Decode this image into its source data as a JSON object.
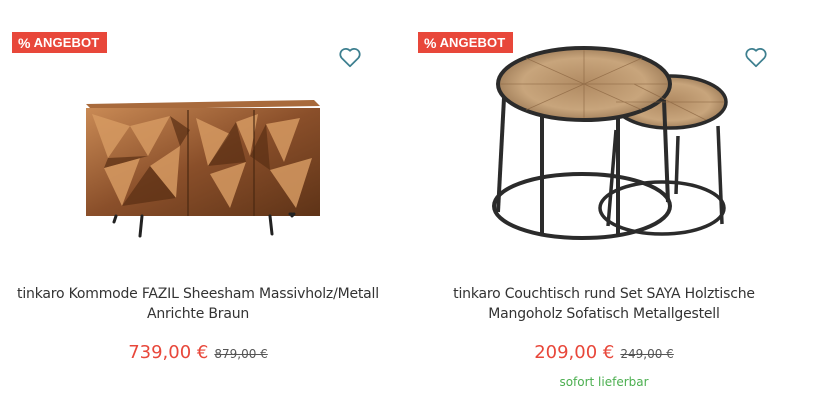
{
  "colors": {
    "badge": "#e8473a",
    "price": "#e8473a",
    "heart": "#3d7f8f",
    "stock": "#4caf50"
  },
  "products": [
    {
      "badge": {
        "icon": "%",
        "label": "ANGEBOT"
      },
      "wishlist_icon": "heart-outline-icon",
      "title_line1": "tinkaro Kommode FAZIL Sheesham Massivholz/Metall",
      "title_line2": "Anrichte Braun",
      "price": "739,00 €",
      "old_price": "879,00 €",
      "stock": ""
    },
    {
      "badge": {
        "icon": "%",
        "label": "ANGEBOT"
      },
      "wishlist_icon": "heart-outline-icon",
      "title_line1": "tinkaro Couchtisch rund Set SAYA Holztische",
      "title_line2": "Mangoholz Sofatisch Metallgestell",
      "price": "209,00 €",
      "old_price": "249,00 €",
      "stock": "sofort lieferbar"
    }
  ]
}
